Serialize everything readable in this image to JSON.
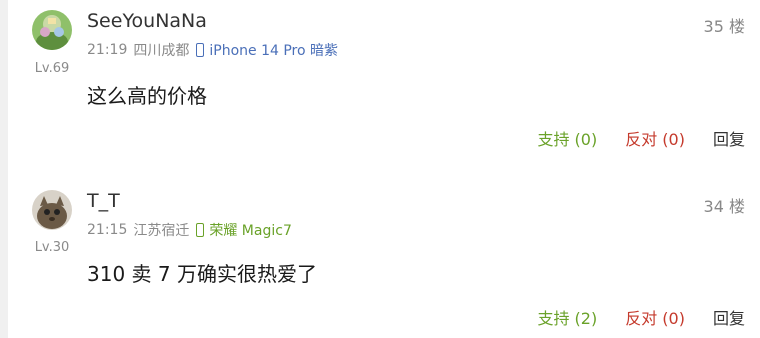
{
  "comments": [
    {
      "username": "SeeYouNaNa",
      "level": "Lv.69",
      "floor": "35 楼",
      "time": "21:19",
      "location": "四川成都",
      "device": "iPhone 14 Pro 暗紫",
      "device_color": "#4a6fb8",
      "content": "这么高的价格",
      "support_label": "支持 (0)",
      "oppose_label": "反对 (0)",
      "reply_label": "回复"
    },
    {
      "username": "T_T",
      "level": "Lv.30",
      "floor": "34 楼",
      "time": "21:15",
      "location": "江苏宿迁",
      "device": "荣耀 Magic7",
      "device_color": "#6aa229",
      "content": "310 卖 7 万确实很热爱了",
      "support_label": "支持 (2)",
      "oppose_label": "反对 (0)",
      "reply_label": "回复"
    }
  ],
  "colors": {
    "support": "#6aa229",
    "oppose": "#c53a2c",
    "meta": "#8a8a8a"
  }
}
